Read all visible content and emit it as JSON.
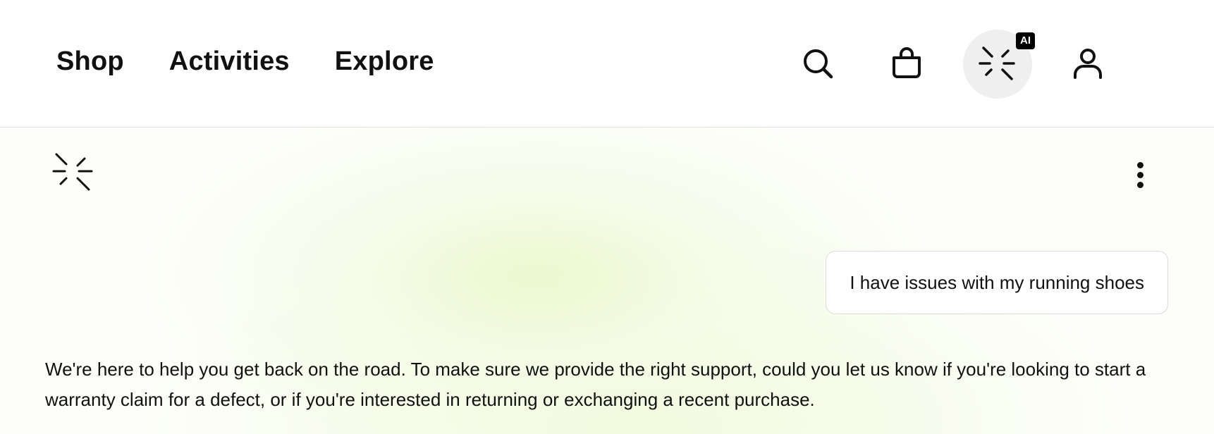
{
  "header": {
    "nav": [
      {
        "label": "Shop"
      },
      {
        "label": "Activities"
      },
      {
        "label": "Explore"
      }
    ],
    "icons": {
      "search": "search-icon",
      "cart": "shopping-bag-icon",
      "ai": "sparkle-icon",
      "account": "user-icon"
    },
    "ai_badge": "AI"
  },
  "chat": {
    "logo": "sparkle-logo-icon",
    "menu_icon": "more-vertical-icon",
    "messages": [
      {
        "role": "user",
        "text": "I have issues with my running shoes"
      },
      {
        "role": "assistant",
        "text": "We're here to help you get back on the road. To make sure we provide the right support, could you let us know if you're looking to start a warranty claim for a defect, or if you're interested in returning or exchanging a recent purchase."
      }
    ]
  },
  "colors": {
    "text": "#111111",
    "ai_button_bg": "#efefef",
    "badge_bg": "#000000",
    "glow": "#eaf8cd"
  }
}
